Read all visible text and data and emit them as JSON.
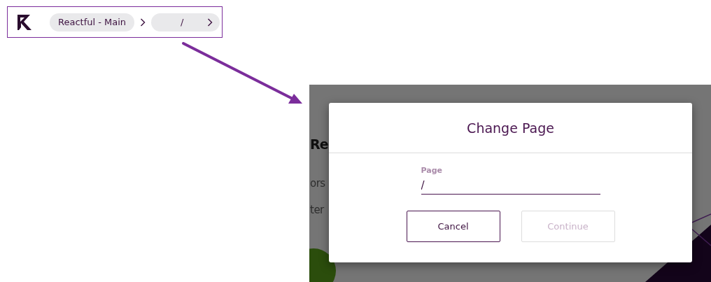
{
  "breadcrumb": {
    "items": [
      {
        "label": "Reactful - Main"
      },
      {
        "label": "/"
      }
    ]
  },
  "background_page": {
    "heading": "Re",
    "lines": [
      "ors",
      "ter"
    ]
  },
  "dialog": {
    "title": "Change Page",
    "field": {
      "label": "Page",
      "value": "/"
    },
    "buttons": [
      {
        "label": "Cancel",
        "disabled": false
      },
      {
        "label": "Continue",
        "disabled": true
      }
    ]
  }
}
